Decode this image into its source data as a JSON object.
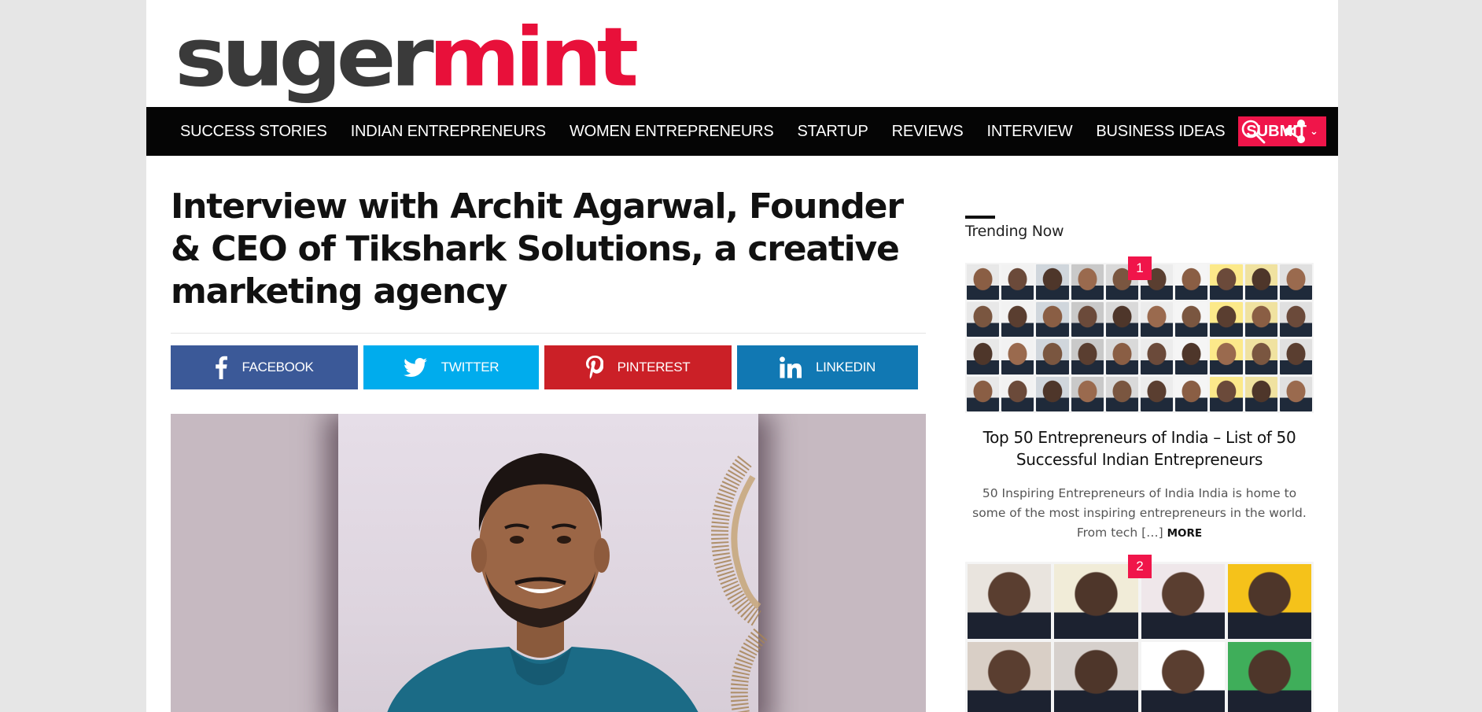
{
  "logo": {
    "part1": "suger",
    "part2": "mint"
  },
  "nav": {
    "items": [
      "SUCCESS STORIES",
      "INDIAN ENTREPRENEURS",
      "WOMEN ENTREPRENEURS",
      "STARTUP",
      "REVIEWS",
      "INTERVIEW",
      "BUSINESS IDEAS"
    ],
    "submit_label": "SUBMIT",
    "icons": [
      "search-icon",
      "share-icon"
    ]
  },
  "article": {
    "title": "Interview with Archit Agarwal, Founder & CEO of Tikshark Solutions, a creative marketing agency",
    "share": {
      "facebook": "FACEBOOK",
      "twitter": "TWITTER",
      "pinterest": "PINTEREST",
      "linkedin": "LINKEDIN"
    }
  },
  "sidebar": {
    "heading": "Trending Now",
    "posts": [
      {
        "rank": "1",
        "title": "Top 50 Entrepreneurs of India – List of 50 Successful Indian Entrepreneurs",
        "excerpt": "50 Inspiring Entrepreneurs of India India is home to some of the most inspiring entrepreneurs in the world. From tech […]",
        "more": "MORE"
      },
      {
        "rank": "2"
      }
    ]
  },
  "colors": {
    "accent": "#f0154a",
    "nav_bg": "#050505",
    "facebook": "#3b5998",
    "twitter": "#00aced",
    "pinterest": "#cb2027",
    "linkedin": "#1178b3"
  }
}
